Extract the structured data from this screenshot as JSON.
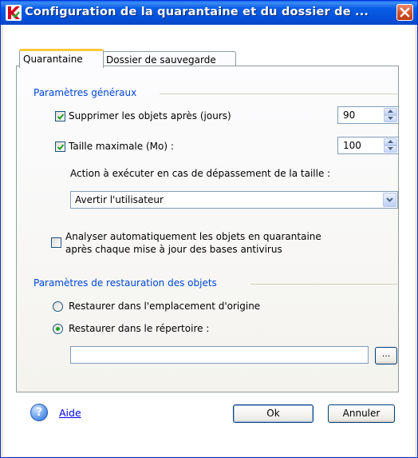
{
  "window": {
    "title": "Configuration de la quarantaine et du dossier de ..."
  },
  "tabs": [
    {
      "label": "Quarantaine",
      "active": true
    },
    {
      "label": "Dossier de sauvegarde",
      "active": false
    }
  ],
  "general": {
    "title": "Paramètres généraux",
    "delete_after": {
      "label": "Supprimer les objets après (jours)",
      "checked": true,
      "value": "90"
    },
    "max_size": {
      "label": "Taille maximale (Mo) :",
      "checked": true,
      "value": "100"
    },
    "action_label": "Action à exécuter en cas de dépassement de la taille :",
    "action_selected": "Avertir l'utilisateur",
    "auto_scan": {
      "label_line1": "Analyser automatiquement les objets en quarantaine",
      "label_line2": "après chaque mise à jour des bases antivirus",
      "checked": false
    }
  },
  "restore": {
    "title": "Paramètres de restauration des objets",
    "original": {
      "label": "Restaurer dans l'emplacement d'origine",
      "selected": false
    },
    "directory": {
      "label": "Restaurer dans le répertoire :",
      "selected": true
    },
    "path_value": "",
    "browse_label": "..."
  },
  "footer": {
    "help_label": "Aide",
    "ok_label": "Ok",
    "cancel_label": "Annuler"
  },
  "colors": {
    "title_bar": "#0a5ee6",
    "group_title": "#0046d5",
    "check_mark": "#21a121",
    "close_button": "#d14b22",
    "brand_red": "#d4001a"
  }
}
